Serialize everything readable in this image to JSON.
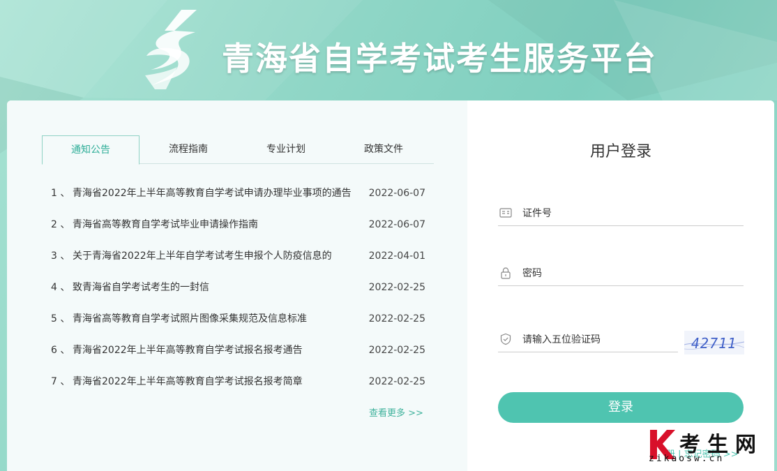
{
  "header": {
    "site_title": "青海省自学考试考生服务平台"
  },
  "tabs": [
    {
      "label": "通知公告",
      "active": true
    },
    {
      "label": "流程指南",
      "active": false
    },
    {
      "label": "专业计划",
      "active": false
    },
    {
      "label": "政策文件",
      "active": false
    }
  ],
  "news": [
    {
      "num": "1 、",
      "title": "青海省2022年上半年高等教育自学考试申请办理毕业事项的通告",
      "date": "2022-06-07"
    },
    {
      "num": "2 、",
      "title": "青海省高等教育自学考试毕业申请操作指南",
      "date": "2022-06-07"
    },
    {
      "num": "3 、",
      "title": "关于青海省2022年上半年自学考试考生申报个人防疫信息的",
      "date": "2022-04-01"
    },
    {
      "num": "4 、",
      "title": "致青海省自学考试考生的一封信",
      "date": "2022-02-25"
    },
    {
      "num": "5 、",
      "title": "青海省高等教育自学考试照片图像采集规范及信息标准",
      "date": "2022-02-25"
    },
    {
      "num": "6 、",
      "title": "青海省2022年上半年高等教育自学考试报名报考通告",
      "date": "2022-02-25"
    },
    {
      "num": "7 、",
      "title": "青海省2022年上半年高等教育自学考试报名报考简章",
      "date": "2022-02-25"
    }
  ],
  "more_label": "查看更多 >>",
  "login": {
    "title": "用户登录",
    "id_placeholder": "证件号",
    "password_placeholder": "密码",
    "captcha_placeholder": "请输入五位验证码",
    "captcha_code": "42711",
    "submit_label": "登录",
    "links_text": "册 | 忘记密码 >>"
  },
  "watermark": {
    "text": "考生网",
    "url": "zikaosw.cn"
  },
  "colors": {
    "accent": "#4fc4b0",
    "tab_active": "#2fae98",
    "watermark_k": "#d8102a"
  },
  "icons": {
    "id_field": "id-card-icon",
    "password_field": "lock-icon",
    "captcha_field": "shield-check-icon"
  }
}
